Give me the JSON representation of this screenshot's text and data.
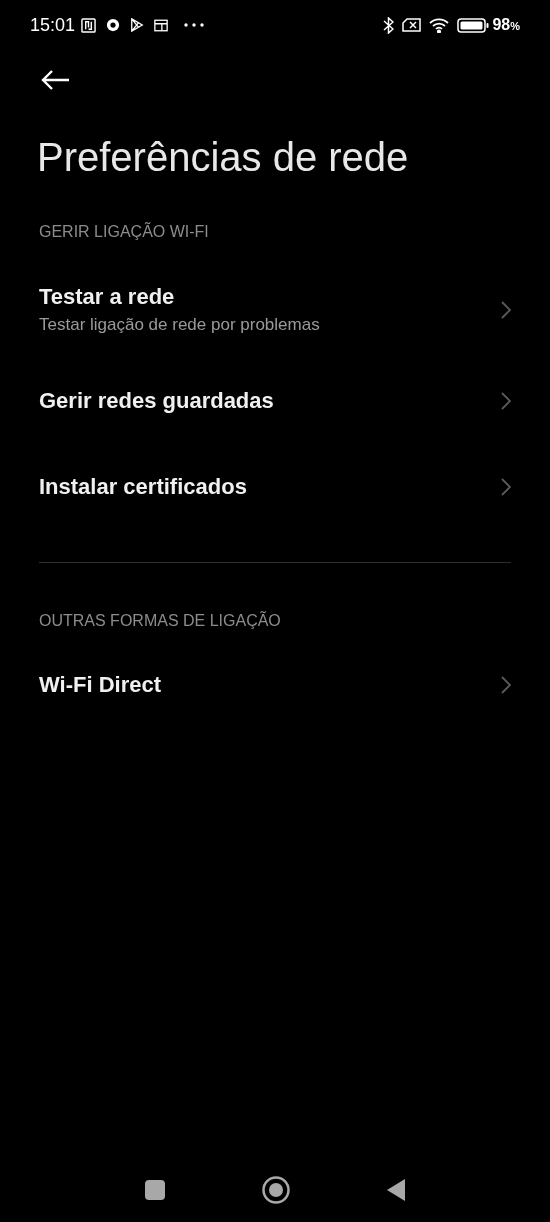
{
  "status_bar": {
    "time": "15:01",
    "battery": "98",
    "battery_unit": "%"
  },
  "title": "Preferências de rede",
  "sections": [
    {
      "header": "GERIR LIGAÇÃO WI-FI",
      "items": [
        {
          "title": "Testar a rede",
          "subtitle": "Testar ligação de rede por problemas"
        },
        {
          "title": "Gerir redes guardadas"
        },
        {
          "title": "Instalar certificados"
        }
      ]
    },
    {
      "header": "OUTRAS FORMAS DE LIGAÇÃO",
      "items": [
        {
          "title": "Wi-Fi Direct"
        }
      ]
    }
  ]
}
